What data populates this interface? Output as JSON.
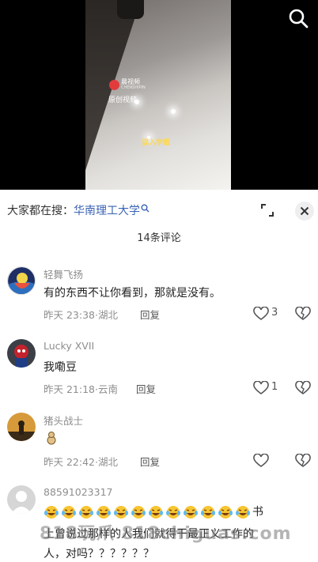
{
  "video": {
    "logo_name": "晨视频",
    "logo_sub": "CHENSHIPIN",
    "original_label": "原创视频",
    "caption": "误入学姐"
  },
  "header": {
    "search_prefix": "大家都在搜：",
    "search_keyword": "华南理工大学",
    "comment_count": "14条评论"
  },
  "comments": [
    {
      "username": "轻舞飞扬",
      "text": "有的东西不让你看到，那就是没有。",
      "time": "昨天 23:38",
      "location": "湖北",
      "reply_label": "回复",
      "likes": "3"
    },
    {
      "username": "Lucky XVII",
      "text": "我嘞豆",
      "time": "昨天 21:18",
      "location": "云南",
      "reply_label": "回复",
      "likes": "1"
    },
    {
      "username": "猪头战士",
      "text": "",
      "time": "昨天 22:42",
      "location": "湖北",
      "reply_label": "回复",
      "likes": ""
    },
    {
      "username": "88591023317",
      "text_suffix": "书",
      "line2": "上曾说过那样的人我们就得干最正义工作的",
      "line3": "人，对吗？？？？？？"
    }
  ],
  "separator": "·",
  "watermark": "818玩爪 818chiguas.com",
  "colors": {
    "keyword": "#3a63b5",
    "caption": "#ffd84a",
    "meta": "#8e8e8e"
  },
  "icons": [
    "search-icon",
    "expand-icon",
    "close-icon",
    "heart-icon",
    "broken-heart-icon",
    "laughing-emoji-icon"
  ]
}
